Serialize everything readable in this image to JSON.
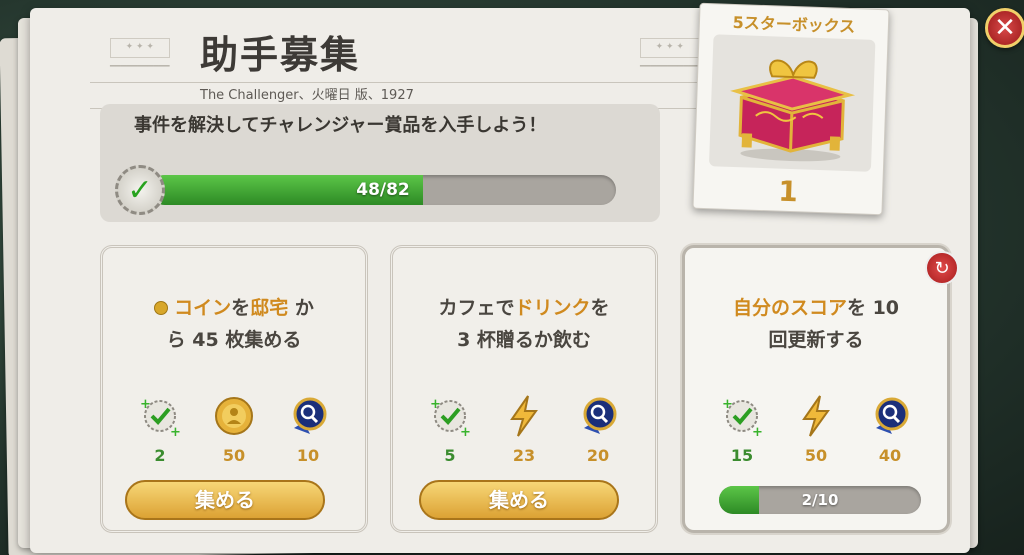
{
  "header": {
    "title": "助手募集",
    "subtitle": "The Challenger、火曜日 版、1927"
  },
  "mission": {
    "text": "事件を解決してチャレンジャー賞品を入手しよう！",
    "progress_text": "48/82",
    "progress": 0.585
  },
  "reward": {
    "title": "5スターボックス",
    "count": "1"
  },
  "tasks": [
    {
      "hl1": "コイン",
      "t1": "を",
      "hl2": "邸宅",
      "t2": " か",
      "line2": "ら 45 枚集める",
      "rewards": {
        "checks": "2",
        "coins": "50",
        "badge": "10"
      },
      "collect_label": "集める"
    },
    {
      "t0": "カフェで",
      "hl1": "ドリンク",
      "t1": "を",
      "line2": "3 杯贈るか飲む",
      "rewards": {
        "checks": "5",
        "energy": "23",
        "badge": "20"
      },
      "collect_label": "集める"
    },
    {
      "hl1": "自分のスコア",
      "t1": "を 10",
      "line2": "回更新する",
      "rewards": {
        "checks": "15",
        "energy": "50",
        "badge": "40"
      },
      "progress_text": "2/10",
      "progress": 0.2
    }
  ],
  "colors": {
    "accent": "#d08a1f",
    "progress": "#3fa831",
    "close": "#c02626"
  },
  "icons": [
    "check-badge-icon",
    "coin-icon",
    "lightning-icon",
    "magnifier-badge-icon",
    "gift-box-icon",
    "close-icon",
    "refresh-icon"
  ]
}
